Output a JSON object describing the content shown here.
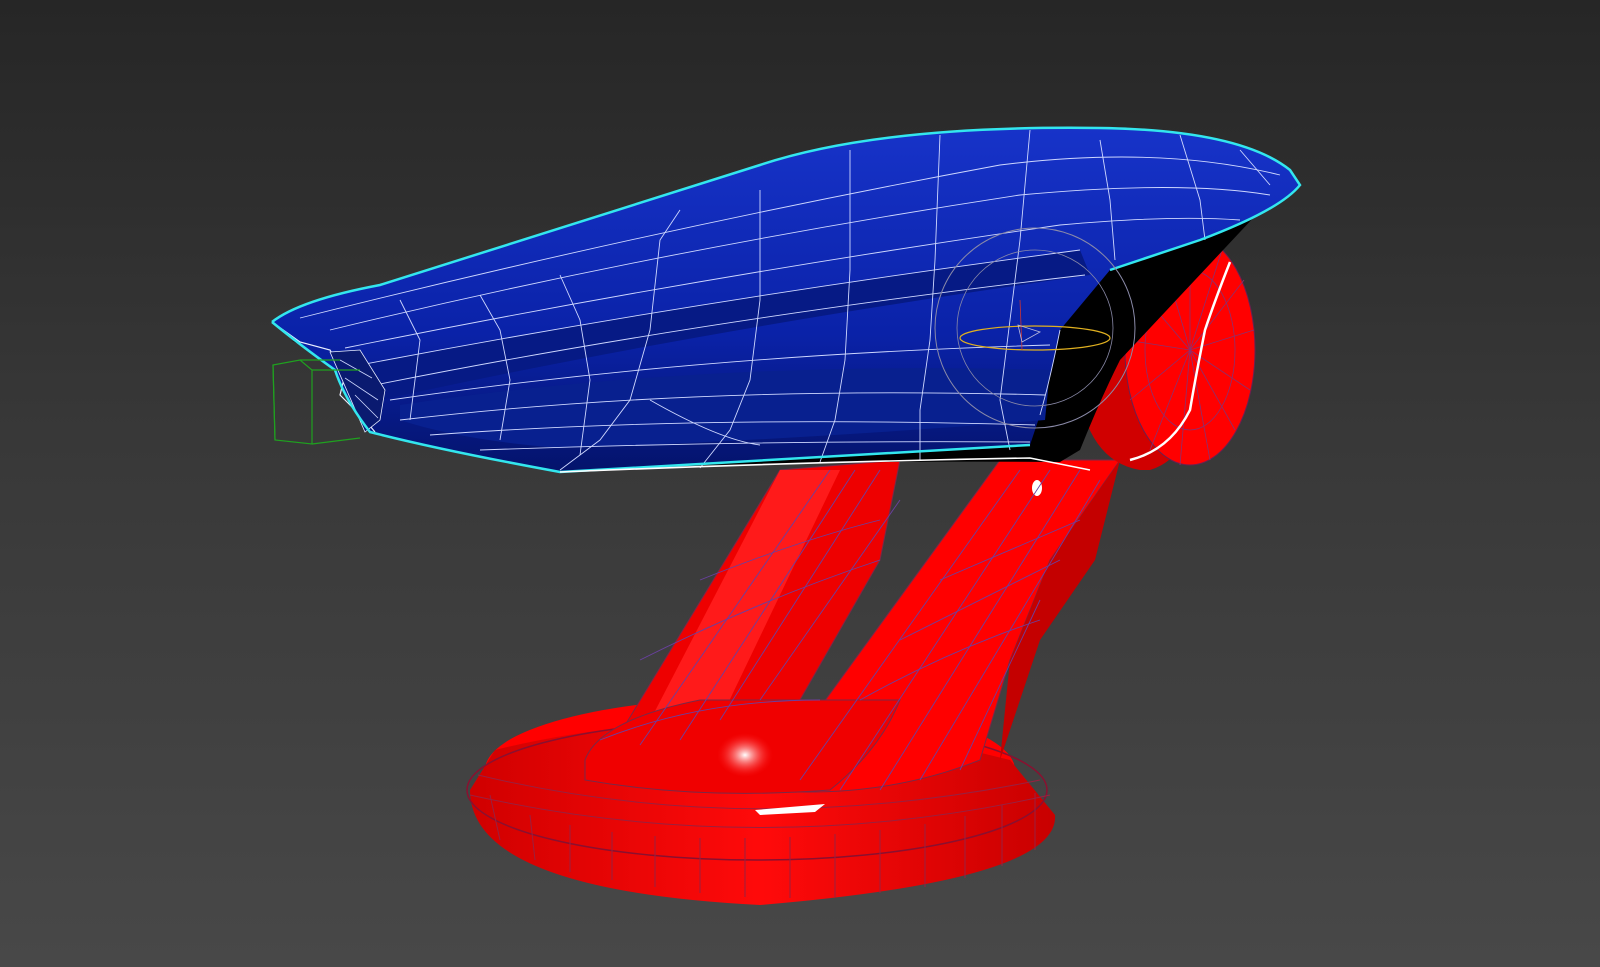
{
  "viewport": {
    "background_top": "#262626",
    "background_bottom": "#484848"
  },
  "model": {
    "body_color": "#0a22a8",
    "body_dark": "#04136b",
    "stand_color": "#ff0000",
    "stand_dark": "#c40000",
    "wire_color": "#d8e4ff",
    "stand_wire_color": "#5a66c8",
    "selection_outline_color": "#33e6ee",
    "helper_box_color": "#1fa11f",
    "gizmo_ring_color": "#8a8aa8",
    "gizmo_axis_color": "#e0b020"
  }
}
